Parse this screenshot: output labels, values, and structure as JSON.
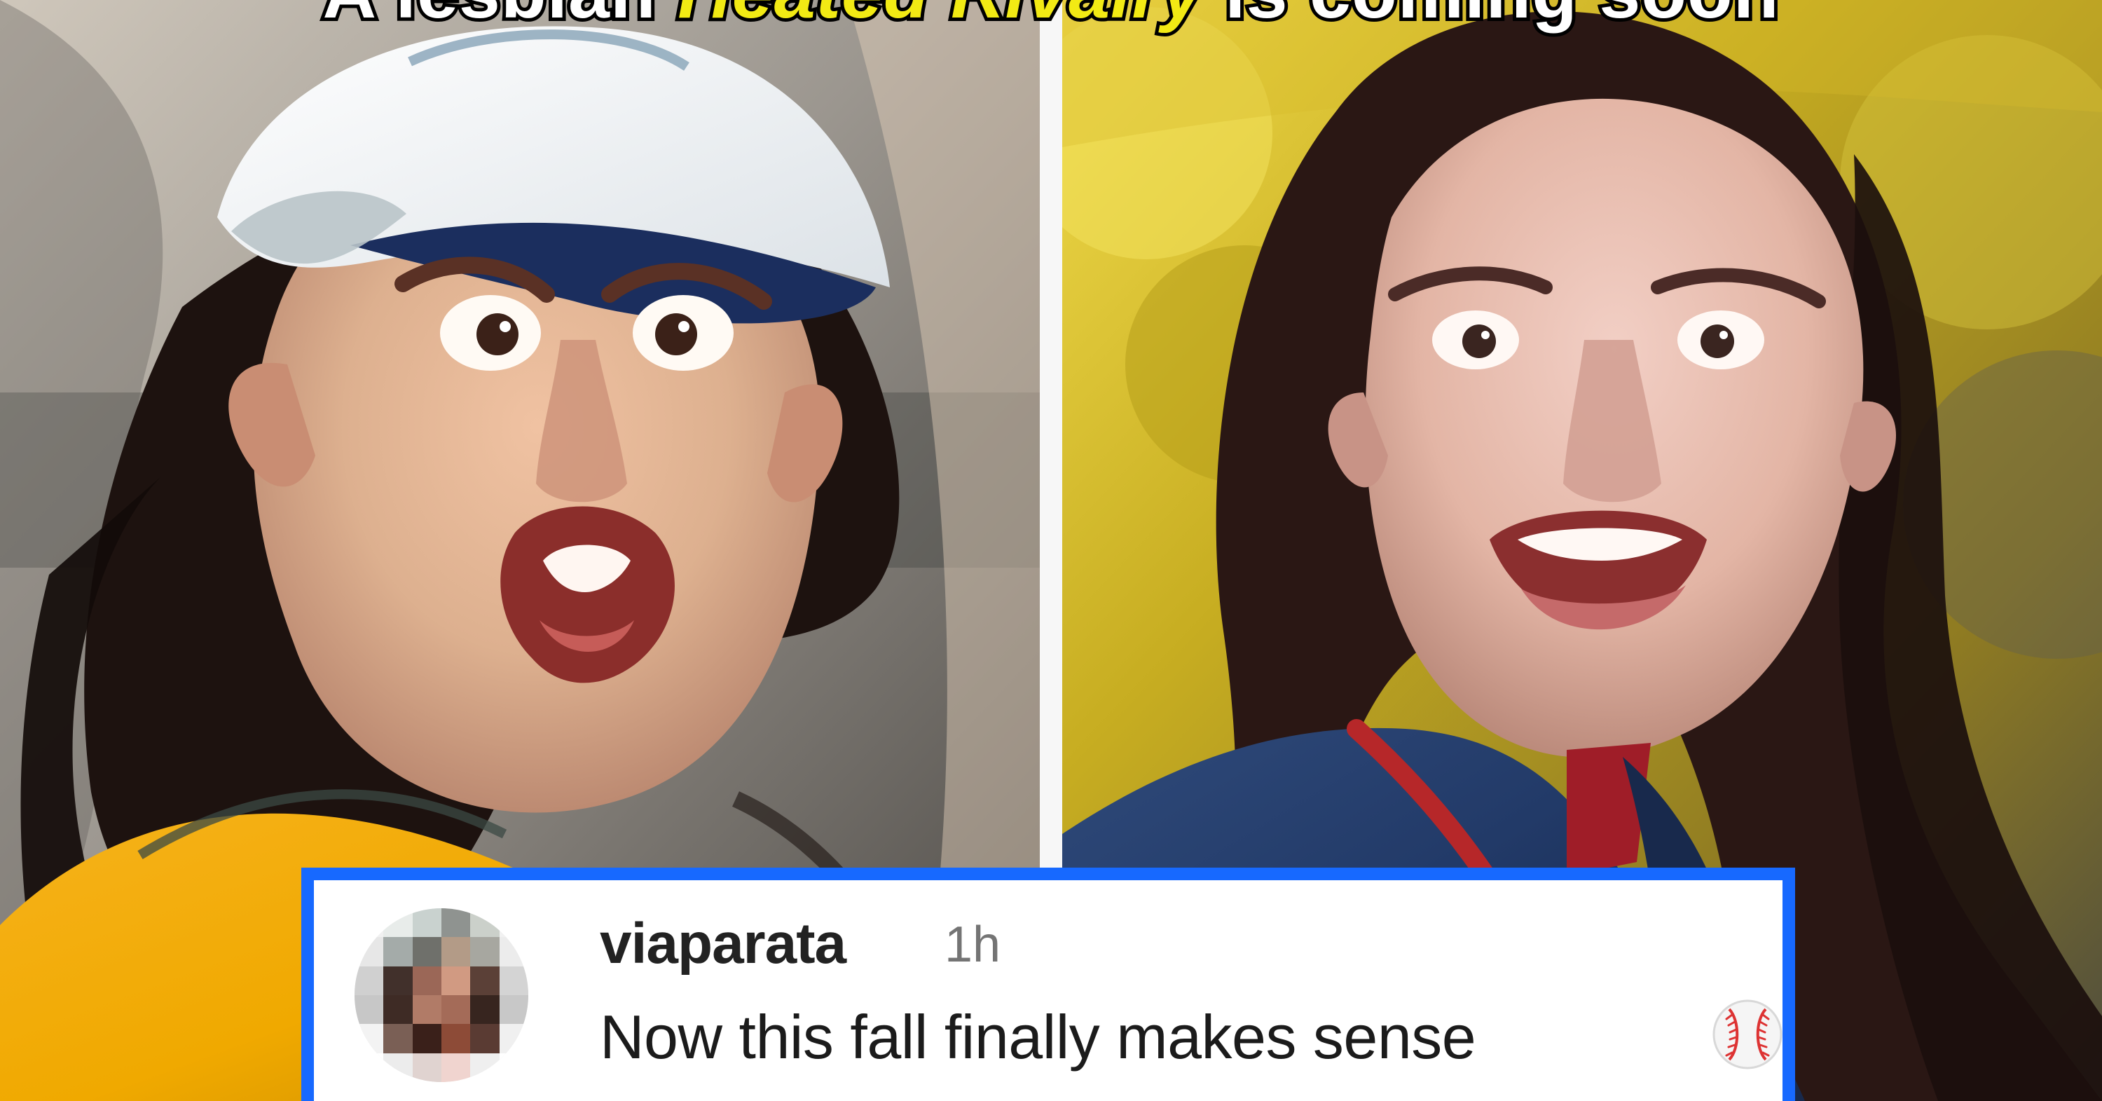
{
  "headline": {
    "prefix": "A lesbian ",
    "italic": "Heated Rivalry",
    "suffix": " is coming soon"
  },
  "comment": {
    "username": "viaparata",
    "time": "1h",
    "text": "Now this fall finally makes sense",
    "icon": "baseball-icon"
  },
  "colors": {
    "comment_border": "#1769ff",
    "headline_highlight": "#f2ea14"
  }
}
